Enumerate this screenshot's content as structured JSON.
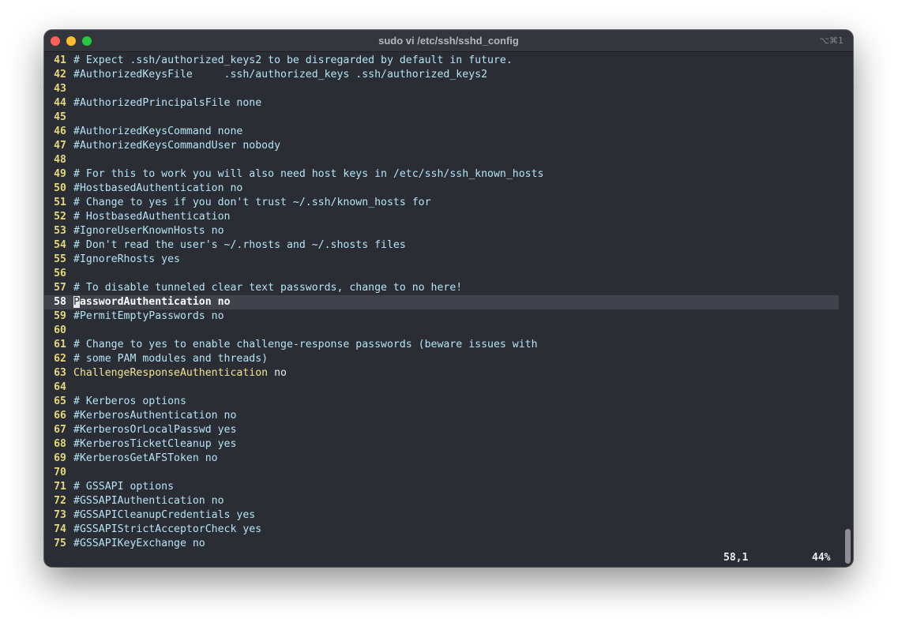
{
  "window": {
    "title": "sudo vi /etc/ssh/sshd_config",
    "shortcut": "⌥⌘1"
  },
  "editor": {
    "lines": [
      {
        "num": "41",
        "text": "# Expect .ssh/authorized_keys2 to be disregarded by default in future."
      },
      {
        "num": "42",
        "text": "#AuthorizedKeysFile     .ssh/authorized_keys .ssh/authorized_keys2"
      },
      {
        "num": "43",
        "text": ""
      },
      {
        "num": "44",
        "text": "#AuthorizedPrincipalsFile none"
      },
      {
        "num": "45",
        "text": ""
      },
      {
        "num": "46",
        "text": "#AuthorizedKeysCommand none"
      },
      {
        "num": "47",
        "text": "#AuthorizedKeysCommandUser nobody"
      },
      {
        "num": "48",
        "text": ""
      },
      {
        "num": "49",
        "text": "# For this to work you will also need host keys in /etc/ssh/ssh_known_hosts"
      },
      {
        "num": "50",
        "text": "#HostbasedAuthentication no"
      },
      {
        "num": "51",
        "text": "# Change to yes if you don't trust ~/.ssh/known_hosts for"
      },
      {
        "num": "52",
        "text": "# HostbasedAuthentication"
      },
      {
        "num": "53",
        "text": "#IgnoreUserKnownHosts no"
      },
      {
        "num": "54",
        "text": "# Don't read the user's ~/.rhosts and ~/.shosts files"
      },
      {
        "num": "55",
        "text": "#IgnoreRhosts yes"
      },
      {
        "num": "56",
        "text": ""
      },
      {
        "num": "57",
        "text": "# To disable tunneled clear text passwords, change to no here!"
      },
      {
        "num": "58",
        "text": "PasswordAuthentication no",
        "cursor_char": "P",
        "rest": "asswordAuthentication no"
      },
      {
        "num": "59",
        "text": "#PermitEmptyPasswords no"
      },
      {
        "num": "60",
        "text": ""
      },
      {
        "num": "61",
        "text": "# Change to yes to enable challenge-response passwords (beware issues with"
      },
      {
        "num": "62",
        "text": "# some PAM modules and threads)"
      },
      {
        "num": "63",
        "text": "ChallengeResponseAuthentication no",
        "key": "ChallengeResponseAuthentication",
        "value": " no"
      },
      {
        "num": "64",
        "text": ""
      },
      {
        "num": "65",
        "text": "# Kerberos options"
      },
      {
        "num": "66",
        "text": "#KerberosAuthentication no"
      },
      {
        "num": "67",
        "text": "#KerberosOrLocalPasswd yes"
      },
      {
        "num": "68",
        "text": "#KerberosTicketCleanup yes"
      },
      {
        "num": "69",
        "text": "#KerberosGetAFSToken no"
      },
      {
        "num": "70",
        "text": ""
      },
      {
        "num": "71",
        "text": "# GSSAPI options"
      },
      {
        "num": "72",
        "text": "#GSSAPIAuthentication no"
      },
      {
        "num": "73",
        "text": "#GSSAPICleanupCredentials yes"
      },
      {
        "num": "74",
        "text": "#GSSAPIStrictAcceptorCheck yes"
      },
      {
        "num": "75",
        "text": "#GSSAPIKeyExchange no"
      }
    ]
  },
  "status": {
    "position": "58,1",
    "percent": "44%"
  }
}
